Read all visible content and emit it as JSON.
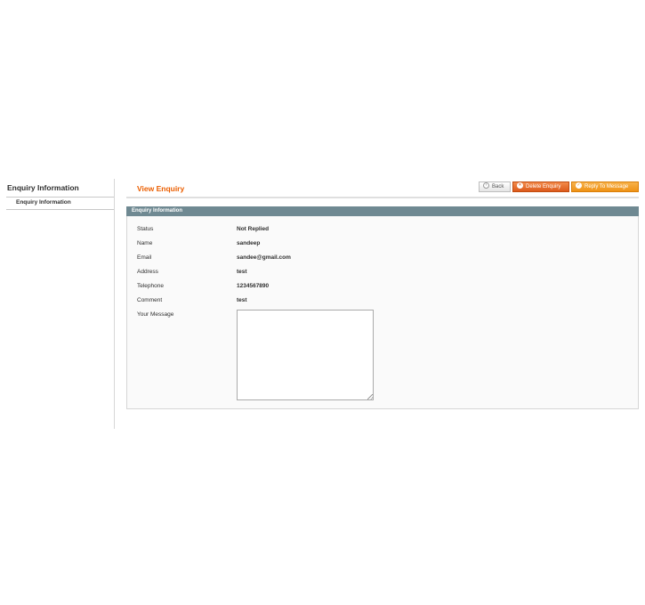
{
  "sidebar": {
    "title": "Enquiry Information",
    "tabs": [
      {
        "label": "Enquiry Information"
      }
    ]
  },
  "header": {
    "title": "View Enquiry",
    "buttons": {
      "back": "Back",
      "delete": "Delete Enquiry",
      "reply": "Reply To Message"
    }
  },
  "fieldset": {
    "legend": "Enquiry Information",
    "rows": [
      {
        "label": "Status",
        "value": "Not Replied"
      },
      {
        "label": "Name",
        "value": "sandeep"
      },
      {
        "label": "Email",
        "value": "sandee@gmail.com"
      },
      {
        "label": "Address",
        "value": "test"
      },
      {
        "label": "Telephone",
        "value": "1234567890"
      },
      {
        "label": "Comment",
        "value": "test"
      }
    ],
    "message_label": "Your Message",
    "message_value": ""
  },
  "colors": {
    "title_orange": "#eb5e00",
    "header_bar": "#6f8992",
    "delete_button": "#dc5a1c",
    "reply_button": "#ef9216"
  }
}
